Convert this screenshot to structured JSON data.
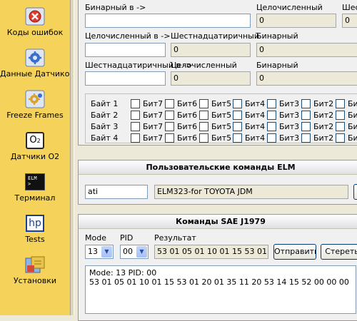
{
  "sidebar": {
    "items": [
      {
        "label": "Коды ошибок",
        "icon": "error-codes-icon"
      },
      {
        "label": "Данные Датчиков",
        "icon": "sensor-data-icon"
      },
      {
        "label": "Freeze Frames",
        "icon": "freeze-frames-icon"
      },
      {
        "label": "Датчики О2",
        "icon": "o2-sensor-icon"
      },
      {
        "label": "Терминал",
        "icon": "terminal-icon"
      },
      {
        "label": "Tests",
        "icon": "tests-icon"
      },
      {
        "label": "Установки",
        "icon": "settings-icon"
      }
    ],
    "o2_icon_text": "O",
    "o2_icon_sub": "2",
    "terminal_icon_text": "ELM",
    "terminal_icon_prompt": ">",
    "tests_icon_text": "hp"
  },
  "converter": {
    "bin_in_label": "Бинарный в ->",
    "bin_in_value": "",
    "bin_dec_label": "Целочисленный",
    "bin_dec_value": "0",
    "bin_hex_label": "Шест",
    "bin_hex_value": "0",
    "dec_in_label": "Целочисленный в ->",
    "dec_in_value": "",
    "dec_hex_label": "Шестнадцатиричный",
    "dec_hex_value": "0",
    "dec_bin_label": "Бинарный",
    "dec_bin_value": "0",
    "hex_in_label": "Шестнадцатиричный в ->",
    "hex_in_value": "",
    "hex_dec_label": "Целочисленный",
    "hex_dec_value": "0",
    "hex_bin_label": "Бинарный",
    "hex_bin_value": "0",
    "bytes": [
      {
        "label": "Байт 1",
        "bits": [
          "Бит7",
          "Бит6",
          "Бит5",
          "Бит4",
          "Бит3",
          "Бит2",
          "Бит1"
        ]
      },
      {
        "label": "Байт 2",
        "bits": [
          "Бит7",
          "Бит6",
          "Бит5",
          "Бит4",
          "Бит3",
          "Бит2",
          "Бит1"
        ]
      },
      {
        "label": "Байт 3",
        "bits": [
          "Бит7",
          "Бит6",
          "Бит5",
          "Бит4",
          "Бит3",
          "Бит2",
          "Бит1"
        ]
      },
      {
        "label": "Байт 4",
        "bits": [
          "Бит7",
          "Бит6",
          "Бит5",
          "Бит4",
          "Бит3",
          "Бит2",
          "Бит1"
        ]
      }
    ]
  },
  "elm": {
    "title": "Пользовательские команды ELM",
    "command_value": "ati",
    "response_value": "ELM323-for TOYOTA JDM"
  },
  "sae": {
    "title": "Команды SAE J1979",
    "mode_label": "Mode",
    "mode_value": "13",
    "pid_label": "PID",
    "pid_value": "00",
    "result_label": "Результат",
    "result_value": "53 01 05 01 10 01 15 53 01 20 0",
    "send_label": "Отправить",
    "clear_label": "Стереть",
    "output_line1": "Mode: 13 PID: 00",
    "output_line2": "53 01 05 01 10 01 15 53 01 20 01 35 11 20 53 14 15 52 00 00 00"
  }
}
